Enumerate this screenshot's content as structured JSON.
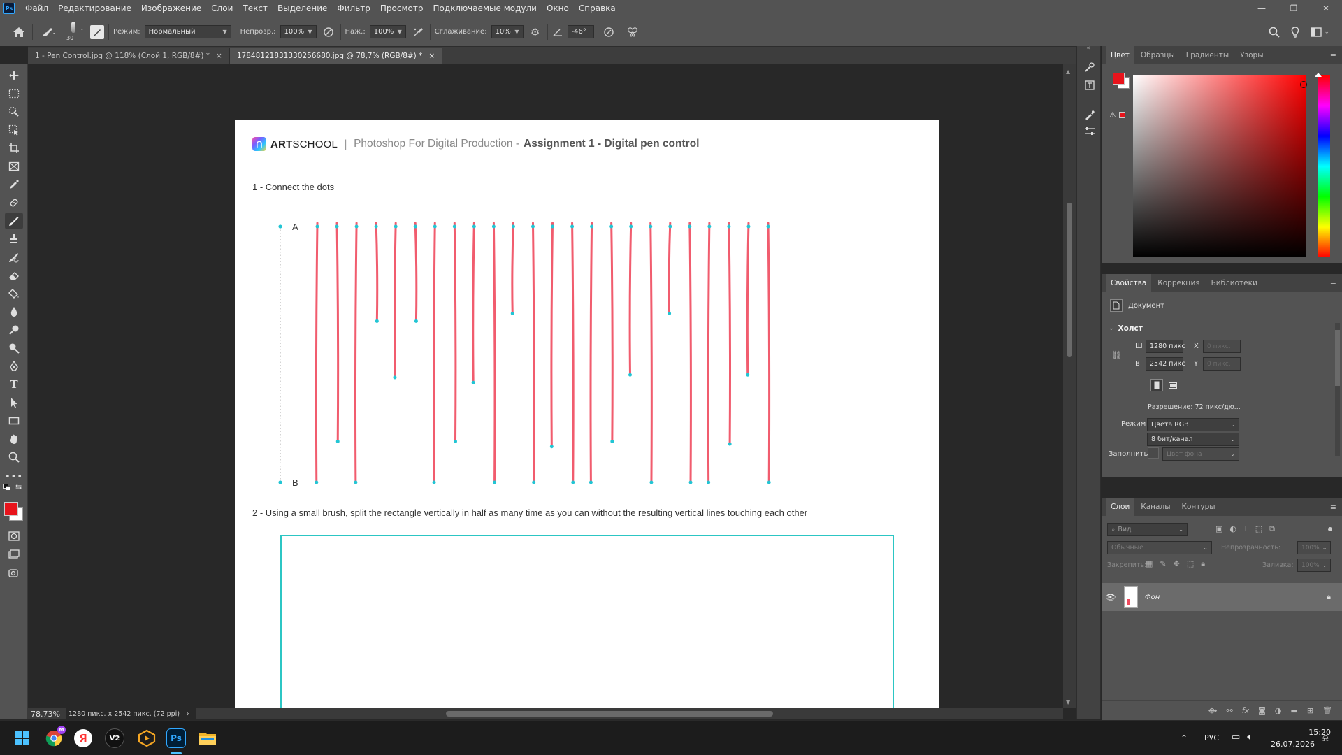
{
  "app": {
    "logo": "Ps"
  },
  "menu": [
    "Файл",
    "Редактирование",
    "Изображение",
    "Слои",
    "Текст",
    "Выделение",
    "Фильтр",
    "Просмотр",
    "Подключаемые модули",
    "Окно",
    "Справка"
  ],
  "window_controls": {
    "minimize": "—",
    "restore": "❐",
    "close": "✕"
  },
  "options": {
    "brush_size": "30",
    "mode_label": "Режим:",
    "mode_value": "Нормальный",
    "opacity_label": "Непрозр.:",
    "opacity_value": "100%",
    "flow_label": "Наж.:",
    "flow_value": "100%",
    "smoothing_label": "Сглаживание:",
    "smoothing_value": "10%",
    "angle_value": "-46°"
  },
  "tabs": [
    {
      "label": "1 - Pen Control.jpg @ 118% (Слой 1, RGB/8#) *",
      "close": "×"
    },
    {
      "label": "17848121831330256680.jpg @ 78,7% (RGB/8#) *",
      "close": "×"
    }
  ],
  "document": {
    "brand_bold": "ART",
    "brand_light": "SCHOOL",
    "separator": "|",
    "course": "Photoshop For Digital Production -",
    "assignment": "Assignment 1 - Digital pen control",
    "step1": "1 - Connect the dots",
    "label_a": "A",
    "label_b": "B",
    "step2": "2 - Using a small brush, split the rectangle vertically in half as many time as you can without the resulting vertical lines touching each other",
    "line_color": "#f04a5e",
    "dot_color": "#22c5d4",
    "rect_color": "#2cc6c4",
    "drawn_line_ends_pct": [
      100,
      84,
      100,
      37,
      59,
      37,
      100,
      84,
      61,
      100,
      34,
      100,
      86,
      100,
      100,
      84,
      58,
      100,
      34,
      100,
      100,
      85,
      58,
      100
    ]
  },
  "status": {
    "zoom": "78.73%",
    "info": "1280 пикс. x 2542 пикс. (72 ppi)",
    "arrow": "›"
  },
  "color_panel": {
    "tabs": [
      "Цвет",
      "Образцы",
      "Градиенты",
      "Узоры"
    ],
    "foreground": "#e8141c",
    "background": "#ffffff"
  },
  "properties": {
    "tabs": [
      "Свойства",
      "Коррекция",
      "Библиотеки"
    ],
    "doc_label": "Документ",
    "section": "Холст",
    "w_label": "Ш",
    "w_value": "1280 пикс",
    "h_label": "В",
    "h_value": "2542 пикс",
    "x_label": "X",
    "x_placeholder": "0 пикс.",
    "y_label": "Y",
    "y_placeholder": "0 пикс.",
    "resolution": "Разрешение: 72 пикс/дю...",
    "mode_label": "Режим",
    "mode_value": "Цвета RGB",
    "depth_value": "8 бит/канал",
    "fill_label": "Заполнить",
    "fill_value": "Цвет фона"
  },
  "layers": {
    "tabs": [
      "Слои",
      "Каналы",
      "Контуры"
    ],
    "search_placeholder": "Вид",
    "blend": "Обычные",
    "opacity_label": "Непрозрачность:",
    "opacity_value": "100%",
    "lock_label": "Закрепить:",
    "fill_label": "Заливка:",
    "fill_value": "100%",
    "items": [
      {
        "name": "Фон"
      }
    ]
  },
  "taskbar": {
    "lang": "РУС",
    "time": "15:20",
    "date": "26.07.2026",
    "yandex_letter": "Я",
    "v2_label": "V2",
    "ps_label": "Ps"
  }
}
